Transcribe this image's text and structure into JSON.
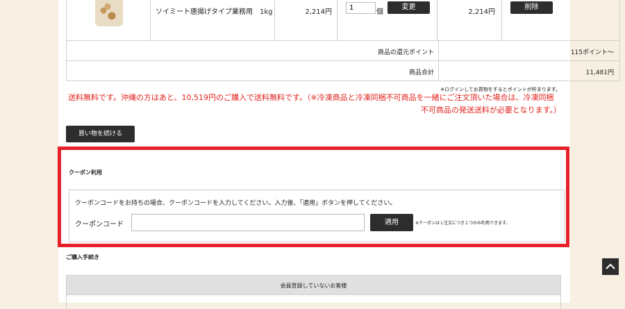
{
  "cart": {
    "item": {
      "name": "ソイミート唐揚げタイプ業務用　1kg",
      "unit_price": "2,214円",
      "quantity": "1",
      "quantity_unit": "個",
      "change_label": "変更",
      "subtotal": "2,214円",
      "delete_label": "削除"
    },
    "points_label": "商品の還元ポイント",
    "points_value": "115ポイント〜",
    "total_label": "商品合計",
    "total_value": "11,481円"
  },
  "login_note": "※ログインしてお買物をするとポイントが貯まります。",
  "shipping": {
    "line1": "送料無料です。沖縄の方はあと、10,519円のご購入で送料無料です。（※冷凍商品と冷凍同梱不可商品を一緒にご注文頂いた場合は、冷凍同梱",
    "line2": "不可商品の発送送料が必要となります。）"
  },
  "continue_label": "買い物を続ける",
  "coupon": {
    "title": "クーポン利用",
    "description": "クーポンコードをお持ちの場合、クーポンコードを入力してください。入力後、「適用」ボタンを押してください。",
    "code_label": "クーポンコード",
    "code_value": "",
    "apply_label": "適用",
    "note": "※クーポンは１注文につき１つのみ利用できます。"
  },
  "purchase": {
    "title": "ご購入手続き",
    "guest_header": "会員登録していないお客様"
  },
  "colors": {
    "background": "#f7f0e2",
    "highlight_border": "#e62129",
    "notice_red": "#e0221c",
    "button_dark": "#2d2d2d"
  },
  "icons": {
    "scroll_top": "chevron-up-icon"
  }
}
